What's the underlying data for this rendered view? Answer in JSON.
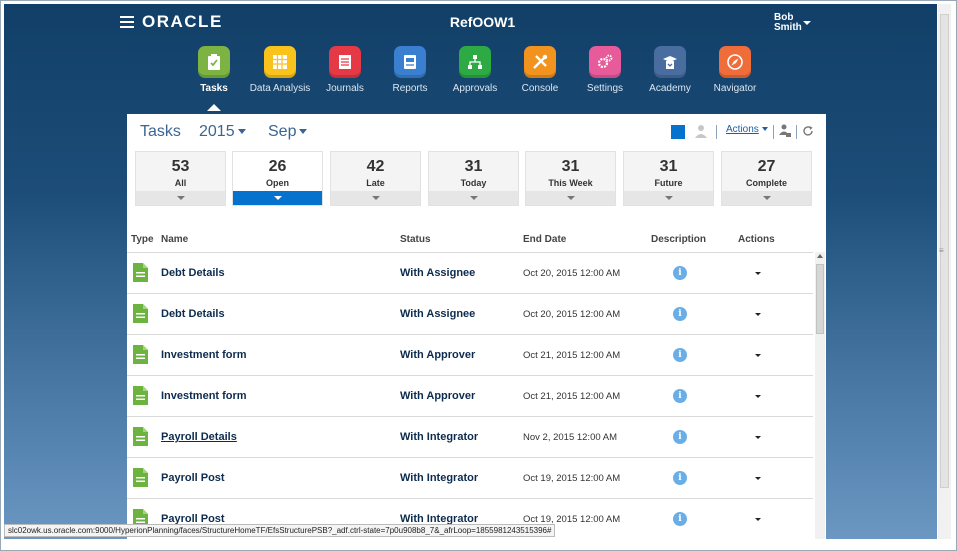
{
  "header": {
    "logo_text": "ORACLE",
    "app_title": "RefOOW1",
    "user_first": "Bob",
    "user_last": "Smith"
  },
  "nav": [
    {
      "label": "Tasks",
      "color": "#7cb342",
      "icon": "clipboard-check-icon",
      "active": true
    },
    {
      "label": "Data Analysis",
      "color": "#f9c31c",
      "icon": "grid-icon"
    },
    {
      "label": "Journals",
      "color": "#e53945",
      "icon": "journal-icon"
    },
    {
      "label": "Reports",
      "color": "#3b7fd0",
      "icon": "report-icon"
    },
    {
      "label": "Approvals",
      "color": "#2eaa44",
      "icon": "hierarchy-icon"
    },
    {
      "label": "Console",
      "color": "#f2921f",
      "icon": "tools-icon"
    },
    {
      "label": "Settings",
      "color": "#e85b9a",
      "icon": "gears-icon"
    },
    {
      "label": "Academy",
      "color": "#4a6da0",
      "icon": "academy-icon"
    },
    {
      "label": "Navigator",
      "color": "#ef6d3b",
      "icon": "compass-icon"
    }
  ],
  "panel": {
    "title": "Tasks",
    "year": "2015",
    "period": "Sep",
    "actions_label": "Actions"
  },
  "counts": [
    {
      "value": "53",
      "label": "All"
    },
    {
      "value": "26",
      "label": "Open",
      "active": true
    },
    {
      "value": "42",
      "label": "Late"
    },
    {
      "value": "31",
      "label": "Today"
    },
    {
      "value": "31",
      "label": "This Week"
    },
    {
      "value": "31",
      "label": "Future"
    },
    {
      "value": "27",
      "label": "Complete"
    }
  ],
  "columns": {
    "type": "Type",
    "name": "Name",
    "status": "Status",
    "end_date": "End Date",
    "description": "Description",
    "actions": "Actions"
  },
  "rows": [
    {
      "name": "Debt Details",
      "status": "With Assignee",
      "end_date": "Oct 20, 2015 12:00 AM"
    },
    {
      "name": "Debt Details",
      "status": "With Assignee",
      "end_date": "Oct 20, 2015 12:00 AM"
    },
    {
      "name": "Investment form",
      "status": "With Approver",
      "end_date": "Oct 21, 2015 12:00 AM"
    },
    {
      "name": "Investment form",
      "status": "With Approver",
      "end_date": "Oct 21, 2015 12:00 AM"
    },
    {
      "name": "Payroll Details",
      "status": "With Integrator",
      "end_date": "Nov 2, 2015 12:00 AM",
      "hover": true
    },
    {
      "name": "Payroll Post",
      "status": "With Integrator",
      "end_date": "Oct 19, 2015 12:00 AM"
    },
    {
      "name": "Payroll Post",
      "status": "With Integrator",
      "end_date": "Oct 19, 2015 12:00 AM"
    }
  ],
  "info_glyph": "i",
  "status_url": "slc02owk.us.oracle.com:9000/HyperionPlanning/faces/StructureHomeTF/EfsStructurePSB?_adf.ctrl-state=7p0u908b8_7&_afrLoop=1855981243515396#"
}
